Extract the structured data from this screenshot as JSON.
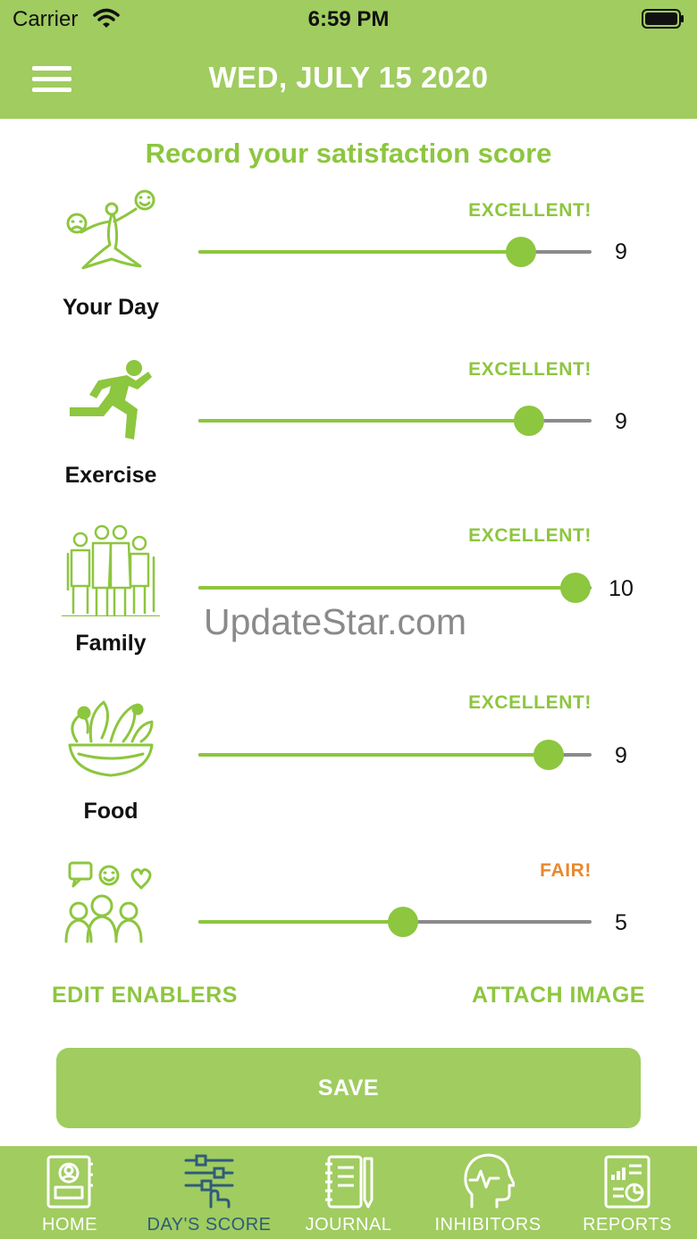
{
  "status_bar": {
    "carrier": "Carrier",
    "time": "6:59 PM"
  },
  "header": {
    "title": "WED, JULY 15 2020"
  },
  "subtitle": "Record your satisfaction score",
  "scores": [
    {
      "label": "Your Day",
      "rating": "EXCELLENT!",
      "value": "9",
      "slider_fraction": 0.82
    },
    {
      "label": "Exercise",
      "rating": "EXCELLENT!",
      "value": "9",
      "slider_fraction": 0.84
    },
    {
      "label": "Family",
      "rating": "EXCELLENT!",
      "value": "10",
      "slider_fraction": 0.96
    },
    {
      "label": "Food",
      "rating": "EXCELLENT!",
      "value": "9",
      "slider_fraction": 0.89
    },
    {
      "label": "",
      "rating": "FAIR!",
      "value": "5",
      "slider_fraction": 0.52
    }
  ],
  "actions": {
    "edit_enablers": "EDIT ENABLERS",
    "attach_image": "ATTACH IMAGE",
    "save": "SAVE"
  },
  "watermark": "UpdateStar.com",
  "tabs": [
    {
      "label": "HOME",
      "icon": "home-icon"
    },
    {
      "label": "DAY'S SCORE",
      "icon": "sliders-icon",
      "active": true
    },
    {
      "label": "JOURNAL",
      "icon": "journal-icon"
    },
    {
      "label": "INHIBITORS",
      "icon": "head-icon"
    },
    {
      "label": "REPORTS",
      "icon": "report-icon"
    }
  ],
  "colors": {
    "brand_green": "#a0cc60",
    "accent_green": "#8dc63f",
    "fair_orange": "#e8892e",
    "active_tab": "#2f5b7a"
  }
}
